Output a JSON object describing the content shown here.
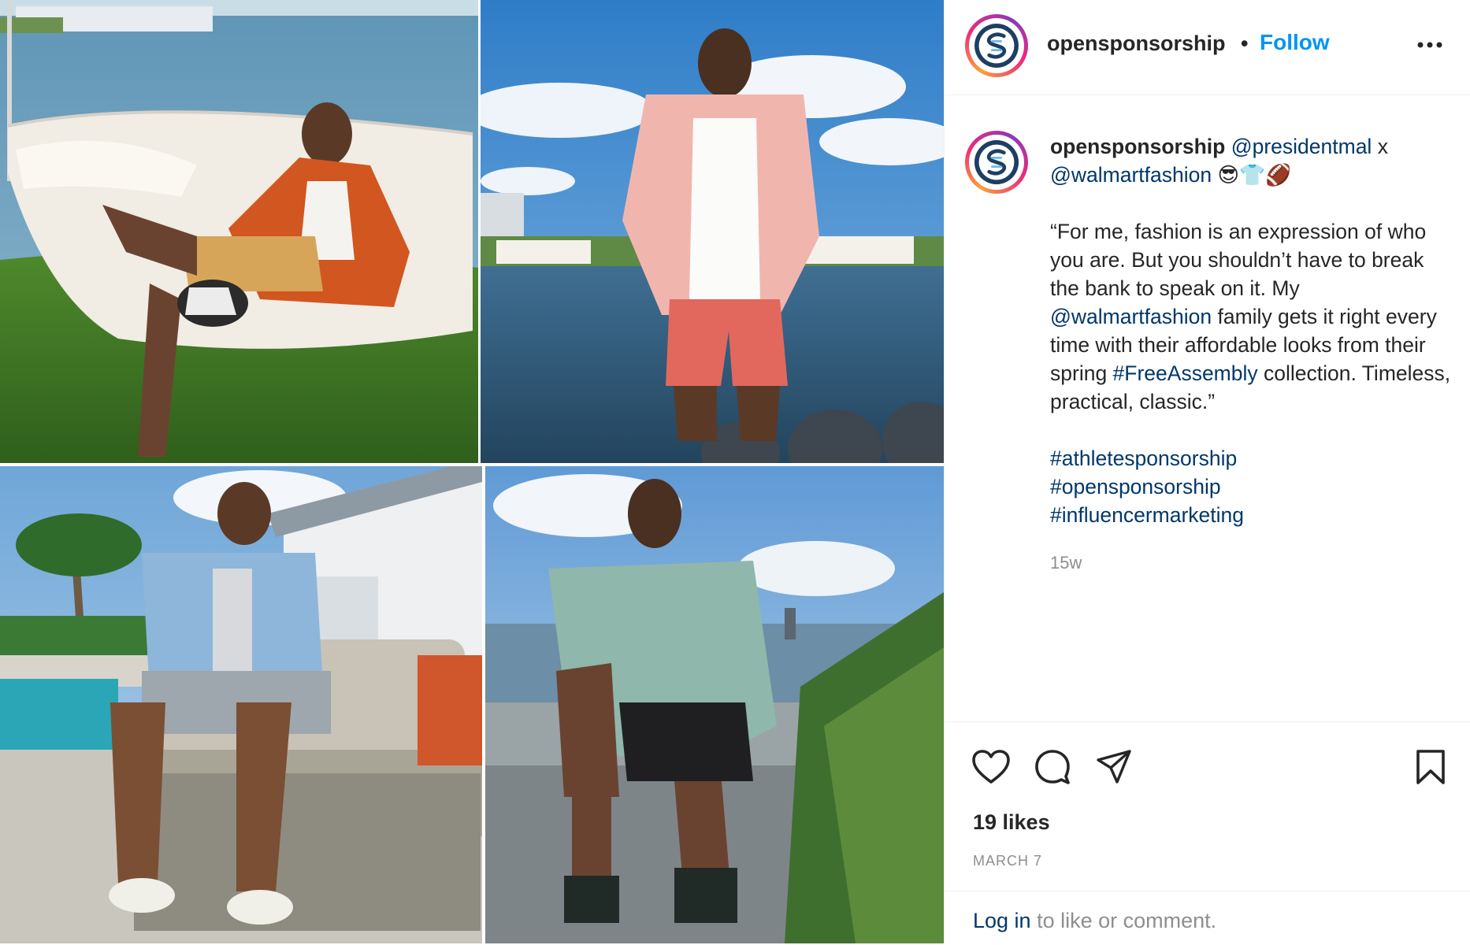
{
  "photos": [
    {
      "alt": "photo-hammock"
    },
    {
      "alt": "photo-dock"
    },
    {
      "alt": "photo-sofa"
    },
    {
      "alt": "photo-seated"
    }
  ],
  "header": {
    "username": "opensponsorship",
    "separator": "•",
    "follow_label": "Follow",
    "more_icon": "more-horizontal-icon"
  },
  "caption": {
    "username": "opensponsorship",
    "mention1": "@presidentmal",
    "connector": " x ",
    "mention2": "@walmartfashion",
    "emojis": "😎👕🏈",
    "quote_part1": "“For me, fashion is an expression of who you are. But you shouldn’t have to break the bank to speak on it. My ",
    "quote_mention": "@walmartfashion",
    "quote_part2": " family gets it right every time with their affordable looks from their spring ",
    "quote_hashtag": "#FreeAssembly",
    "quote_part3": " collection. Timeless, practical, classic.”",
    "hashtags": [
      "#athletesponsorship",
      "#opensponsorship",
      "#influencermarketing"
    ],
    "time_ago": "15w"
  },
  "actions": {
    "like_icon": "heart-icon",
    "comment_icon": "comment-icon",
    "share_icon": "send-icon",
    "save_icon": "bookmark-icon",
    "likes": "19 likes",
    "date": "MARCH 7",
    "login_link": "Log in",
    "login_rest": " to like or comment."
  },
  "colors": {
    "follow": "#0095f6",
    "link": "#00376b",
    "muted": "#8e8e8e",
    "text": "#262626"
  }
}
